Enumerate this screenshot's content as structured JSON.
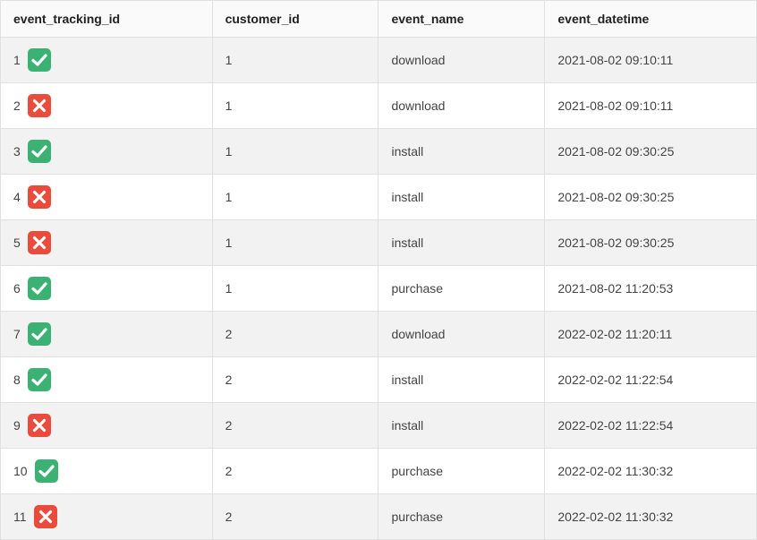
{
  "columns": {
    "event_tracking_id": "event_tracking_id",
    "customer_id": "customer_id",
    "event_name": "event_name",
    "event_datetime": "event_datetime"
  },
  "rows": [
    {
      "id": "1",
      "status": "check",
      "customer_id": "1",
      "event_name": "download",
      "event_datetime": "2021-08-02 09:10:11"
    },
    {
      "id": "2",
      "status": "cross",
      "customer_id": "1",
      "event_name": "download",
      "event_datetime": "2021-08-02 09:10:11"
    },
    {
      "id": "3",
      "status": "check",
      "customer_id": "1",
      "event_name": "install",
      "event_datetime": "2021-08-02 09:30:25"
    },
    {
      "id": "4",
      "status": "cross",
      "customer_id": "1",
      "event_name": "install",
      "event_datetime": "2021-08-02 09:30:25"
    },
    {
      "id": "5",
      "status": "cross",
      "customer_id": "1",
      "event_name": "install",
      "event_datetime": "2021-08-02 09:30:25"
    },
    {
      "id": "6",
      "status": "check",
      "customer_id": "1",
      "event_name": "purchase",
      "event_datetime": "2021-08-02 11:20:53"
    },
    {
      "id": "7",
      "status": "check",
      "customer_id": "2",
      "event_name": "download",
      "event_datetime": "2022-02-02 11:20:11"
    },
    {
      "id": "8",
      "status": "check",
      "customer_id": "2",
      "event_name": "install",
      "event_datetime": "2022-02-02 11:22:54"
    },
    {
      "id": "9",
      "status": "cross",
      "customer_id": "2",
      "event_name": "install",
      "event_datetime": "2022-02-02 11:22:54"
    },
    {
      "id": "10",
      "status": "check",
      "customer_id": "2",
      "event_name": "purchase",
      "event_datetime": "2022-02-02 11:30:32"
    },
    {
      "id": "11",
      "status": "cross",
      "customer_id": "2",
      "event_name": "purchase",
      "event_datetime": "2022-02-02 11:30:32"
    }
  ],
  "icons": {
    "check": "check-icon",
    "cross": "cross-icon"
  }
}
